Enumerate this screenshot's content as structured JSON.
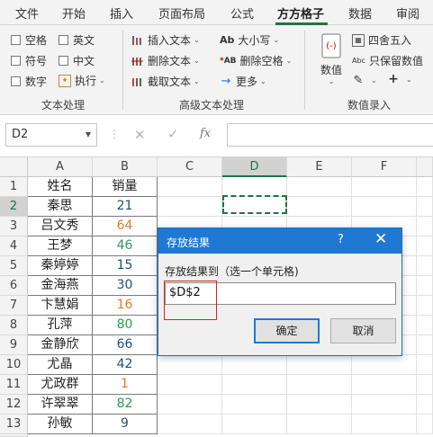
{
  "ribbon_tabs": [
    "文件",
    "开始",
    "插入",
    "页面布局",
    "公式",
    "方方格子",
    "数据",
    "审阅"
  ],
  "active_tab": "方方格子",
  "text_group": {
    "checkboxes": [
      "空格",
      "英文",
      "符号",
      "中文",
      "数字"
    ],
    "exec_label": "执行",
    "label": "文本处理"
  },
  "adv_group": {
    "items": [
      "插入文本",
      "删除文本",
      "截取文本",
      "大小写",
      "删除空格",
      "更多"
    ],
    "label": "高级文本处理"
  },
  "num_group": {
    "big_button": "数值",
    "items": [
      "四舍五入",
      "只保留数值"
    ],
    "label": "数值录入"
  },
  "formula_bar": {
    "name_box": "D2",
    "fx": "fx",
    "value": ""
  },
  "columns": [
    "A",
    "B",
    "C",
    "D",
    "E",
    "F"
  ],
  "selected_column": "D",
  "rows": [
    {
      "num": "1",
      "name": "姓名",
      "sales": "销量",
      "color": "#222222"
    },
    {
      "num": "2",
      "name": "秦思",
      "sales": "21",
      "color": "#1f4e79"
    },
    {
      "num": "3",
      "name": "吕文秀",
      "sales": "64",
      "color": "#e07b22"
    },
    {
      "num": "4",
      "name": "王梦",
      "sales": "46",
      "color": "#22a050"
    },
    {
      "num": "5",
      "name": "秦婷婷",
      "sales": "15",
      "color": "#1f4e79"
    },
    {
      "num": "6",
      "name": "金海燕",
      "sales": "30",
      "color": "#1f4e79"
    },
    {
      "num": "7",
      "name": "卞慧娟",
      "sales": "16",
      "color": "#e07b22"
    },
    {
      "num": "8",
      "name": "孔萍",
      "sales": "80",
      "color": "#22a050"
    },
    {
      "num": "9",
      "name": "金静欣",
      "sales": "66",
      "color": "#1f4e79"
    },
    {
      "num": "10",
      "name": "尤晶",
      "sales": "42",
      "color": "#1f4e79"
    },
    {
      "num": "11",
      "name": "尤政群",
      "sales": "1",
      "color": "#e07b22"
    },
    {
      "num": "12",
      "name": "许翠翠",
      "sales": "82",
      "color": "#22a050"
    },
    {
      "num": "13",
      "name": "孙敏",
      "sales": "9",
      "color": "#1f4e79"
    }
  ],
  "dialog": {
    "title": "存放结果",
    "help": "?",
    "close": "✕",
    "label": "存放结果到（选一个单元格)",
    "input_value": "$D$2",
    "ok": "确定",
    "cancel": "取消"
  },
  "colors": {
    "accent_green": "#217346",
    "dialog_blue": "#1e79d4",
    "highlight_red": "#e02020"
  }
}
